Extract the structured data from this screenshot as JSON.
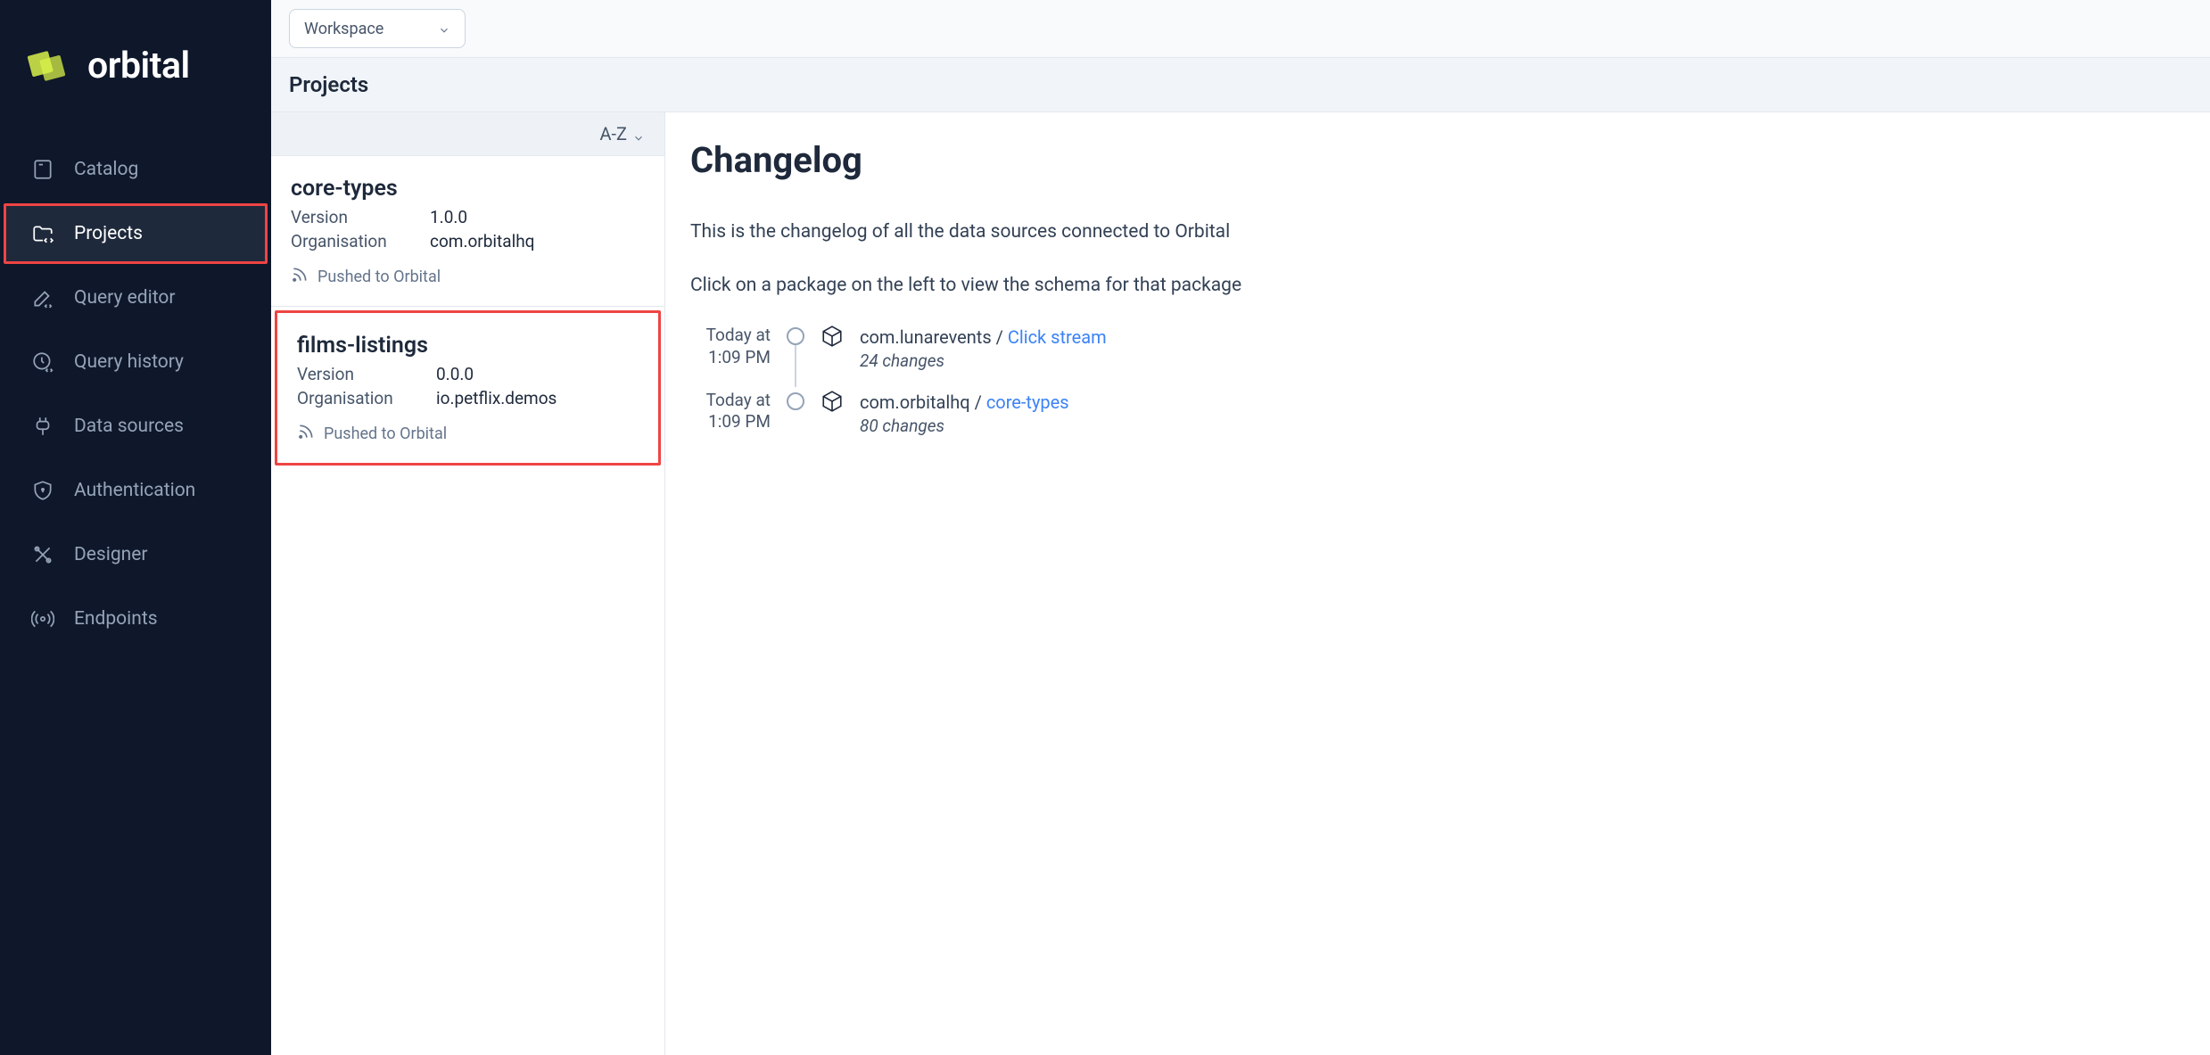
{
  "app_name": "orbital",
  "workspace_label": "Workspace",
  "page_title": "Projects",
  "sort_label": "A-Z",
  "sidebar": {
    "items": [
      {
        "label": "Catalog"
      },
      {
        "label": "Projects"
      },
      {
        "label": "Query editor"
      },
      {
        "label": "Query history"
      },
      {
        "label": "Data sources"
      },
      {
        "label": "Authentication"
      },
      {
        "label": "Designer"
      },
      {
        "label": "Endpoints"
      }
    ]
  },
  "projects": [
    {
      "name": "core-types",
      "version_label": "Version",
      "version": "1.0.0",
      "org_label": "Organisation",
      "org": "com.orbitalhq",
      "status": "Pushed to Orbital"
    },
    {
      "name": "films-listings",
      "version_label": "Version",
      "version": "0.0.0",
      "org_label": "Organisation",
      "org": "io.petflix.demos",
      "status": "Pushed to Orbital"
    }
  ],
  "changelog": {
    "title": "Changelog",
    "intro": "This is the changelog of all the data sources connected to Orbital",
    "hint": "Click on a package on the left to view the schema for that package",
    "entries": [
      {
        "time_line1": "Today at",
        "time_line2": "1:09 PM",
        "org": "com.lunarevents / ",
        "link": "Click stream",
        "changes": "24 changes"
      },
      {
        "time_line1": "Today at",
        "time_line2": "1:09 PM",
        "org": "com.orbitalhq / ",
        "link": "core-types",
        "changes": "80 changes"
      }
    ]
  }
}
